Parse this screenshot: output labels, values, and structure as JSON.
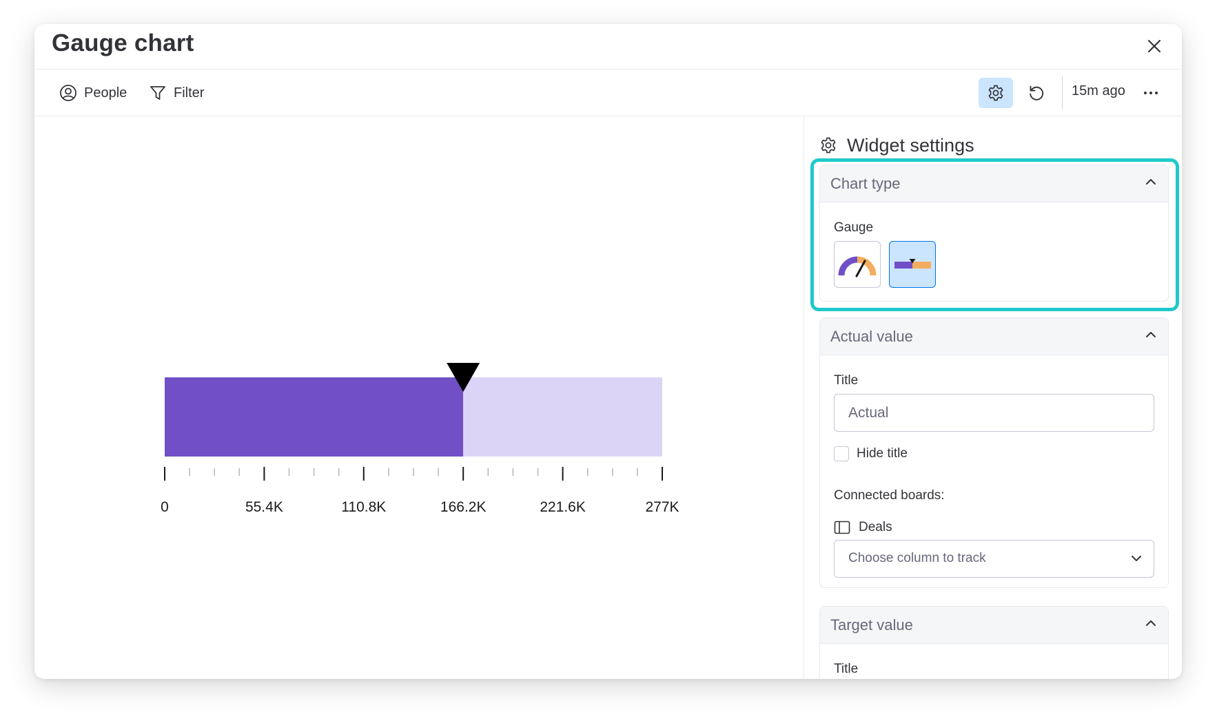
{
  "window": {
    "title": "Gauge chart"
  },
  "toolbar": {
    "people_label": "People",
    "filter_label": "Filter",
    "last_updated": "15m ago"
  },
  "chart_data": {
    "type": "bar",
    "subtype": "linear-gauge",
    "min": 0,
    "max": 277000,
    "value": 166200,
    "tick_labels": [
      "0",
      "55.4K",
      "110.8K",
      "166.2K",
      "221.6K",
      "277K"
    ],
    "tick_values": [
      0,
      55400,
      110800,
      166200,
      221600,
      277000
    ],
    "minor_ticks_per_interval": 3,
    "colors": {
      "filled": "#7150c7",
      "remaining": "#dcd4f7",
      "marker": "#000000",
      "ticks_major": "#1a1a1a",
      "ticks_minor": "#b8b8b8"
    }
  },
  "settings": {
    "header": "Widget settings",
    "chart_type": {
      "title": "Chart type",
      "gauge_label": "Gauge",
      "options": [
        {
          "name": "radial-gauge",
          "selected": false
        },
        {
          "name": "linear-gauge",
          "selected": true
        }
      ]
    },
    "actual_value": {
      "title": "Actual value",
      "field_title_label": "Title",
      "title_placeholder": "Actual",
      "hide_title_label": "Hide title",
      "connected_boards_label": "Connected boards:",
      "board_name": "Deals",
      "column_placeholder": "Choose column to track"
    },
    "target_value": {
      "title": "Target value",
      "field_title_label": "Title"
    }
  },
  "colors": {
    "accent": "#0073ea",
    "selected_bg": "#cce5ff",
    "highlight_outline": "#1fc9cb"
  }
}
